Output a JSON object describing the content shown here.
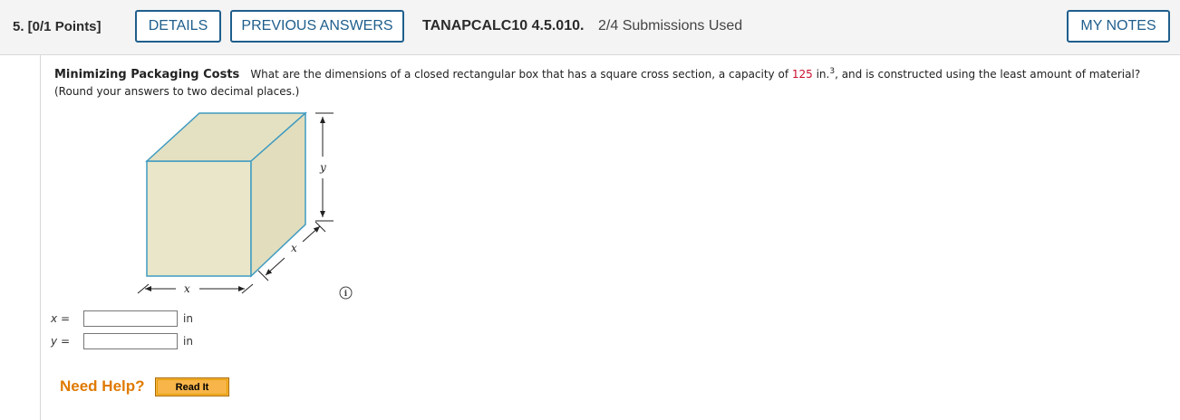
{
  "header": {
    "question_number": "5. [0/1 Points]",
    "details_label": "DETAILS",
    "previous_answers_label": "PREVIOUS ANSWERS",
    "problem_code": "TANAPCALC10 4.5.010.",
    "submissions": "2/4 Submissions Used",
    "my_notes_label": "MY NOTES"
  },
  "question": {
    "title": "Minimizing Packaging Costs",
    "text_before": "What are the dimensions of a closed rectangular box that has a square cross section, a capacity of ",
    "capacity_value": "125",
    "capacity_unit": " in.",
    "capacity_exp": "3",
    "text_after": ", and is constructed using the least amount of material? (Round your answers to two decimal places.)"
  },
  "figure": {
    "label_y": "y",
    "label_x_depth": "x",
    "label_x_width": "x"
  },
  "answers": [
    {
      "var": "x",
      "equals": "=",
      "value": "",
      "unit": "in"
    },
    {
      "var": "y",
      "equals": "=",
      "value": "",
      "unit": "in"
    }
  ],
  "help": {
    "need_help": "Need Help?",
    "read_it_label": "Read It"
  },
  "colors": {
    "button_border": "#1f5e8c",
    "box_fill": "#e9e6c9",
    "box_edge": "#3f9bc1",
    "highlight_red": "#c8102e",
    "help_orange": "#e07a00"
  }
}
